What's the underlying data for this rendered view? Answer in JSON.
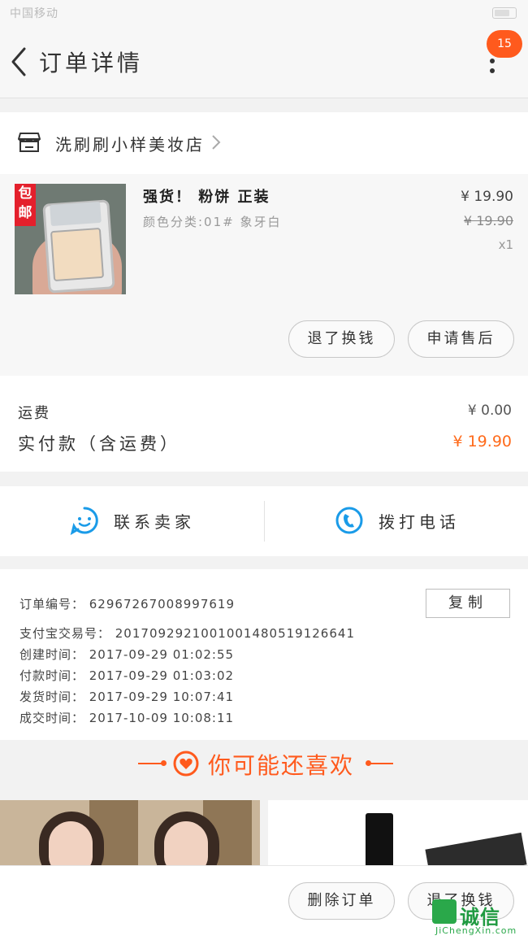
{
  "status_bar": {
    "carrier": "中国移动",
    "time": ""
  },
  "header": {
    "title": "订单详情",
    "badge_count": "15"
  },
  "shop": {
    "name": "洗刷刷小样美妆店"
  },
  "product": {
    "title": "强货！ 粉饼 正装",
    "spec": "颜色分类:01# 象牙白",
    "price_now": "¥ 19.90",
    "price_old": "¥ 19.90",
    "quantity": "x1",
    "tag": "包邮",
    "buttons": [
      "退了换钱",
      "申请售后"
    ]
  },
  "totals": {
    "shipping_label": "运费",
    "shipping_value": "¥ 0.00",
    "paid_label": "实付款（含运费）",
    "paid_value": "¥ 19.90"
  },
  "contact": {
    "chat_label": "联系卖家",
    "call_label": "拨打电话"
  },
  "order_info": {
    "lines": [
      "订单编号：  62967267008997619",
      "支付宝交易号：  2017092921001001480519126641",
      "创建时间：  2017-09-29 01:02:55",
      "付款时间：  2017-09-29 01:03:02",
      "发货时间：  2017-09-29 10:07:41",
      "成交时间：  2017-10-09 10:08:11"
    ],
    "copy_label": "复制"
  },
  "recommend": {
    "title": "你可能还喜欢"
  },
  "bottom_bar": {
    "buttons": [
      "删除订单",
      "退了换钱"
    ]
  },
  "watermark": {
    "text": "诚信",
    "sub": "JiChengXin.com"
  },
  "colors": {
    "accent": "#ff5a1d",
    "icon_blue": "#1a9be8"
  }
}
